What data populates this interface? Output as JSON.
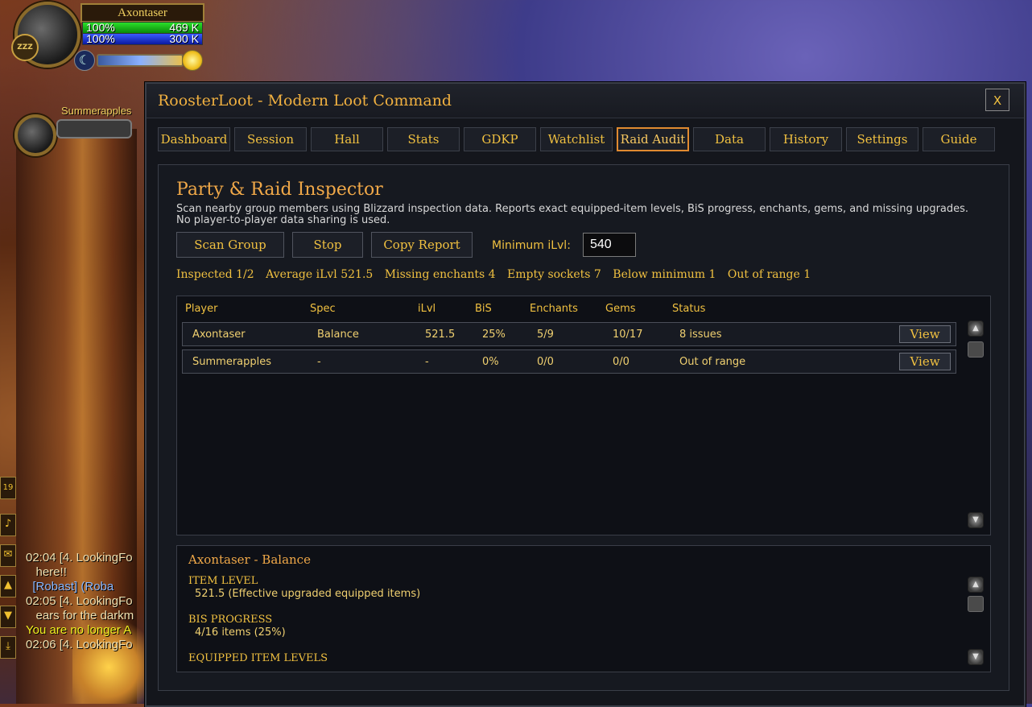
{
  "player": {
    "name": "Axontaser",
    "hp_pct": "100%",
    "hp_val": "469 K",
    "mp_pct": "100%",
    "mp_val": "300 K",
    "rest": "ZZZ"
  },
  "party": {
    "name": "Summerapples"
  },
  "chat": {
    "button_count": "19",
    "lines": [
      {
        "text": "02:04 [4. LookingFo",
        "kind": "normal"
      },
      {
        "text": "   here!!",
        "kind": "normal"
      },
      {
        "text": "  [Robast] (Roba",
        "kind": "who"
      },
      {
        "text": "02:05 [4. LookingFo",
        "kind": "normal"
      },
      {
        "text": "   ears for the darkm",
        "kind": "normal"
      },
      {
        "text": "You are no longer A",
        "kind": "sys"
      },
      {
        "text": "02:06 [4. LookingFo",
        "kind": "normal"
      }
    ]
  },
  "window": {
    "title": "RoosterLoot - Modern Loot Command",
    "close_label": "X",
    "tabs": [
      "Dashboard",
      "Session",
      "Hall",
      "Stats",
      "GDKP",
      "Watchlist",
      "Raid Audit",
      "Data",
      "History",
      "Settings",
      "Guide"
    ],
    "active_tab": "Raid Audit"
  },
  "inspector": {
    "title": "Party & Raid Inspector",
    "description": "Scan nearby group members using Blizzard inspection data. Reports exact equipped-item levels, BiS progress, enchants, gems, and missing upgrades. No player-to-player data sharing is used.",
    "scan_label": "Scan Group",
    "stop_label": "Stop",
    "copy_label": "Copy Report",
    "min_ilvl_label": "Minimum iLvl:",
    "min_ilvl_value": "540",
    "summary": {
      "inspected": "Inspected 1/2",
      "avg": "Average iLvl 521.5",
      "enchants": "Missing enchants 4",
      "sockets": "Empty sockets 7",
      "below": "Below minimum 1",
      "range": "Out of range 1"
    },
    "columns": [
      "Player",
      "Spec",
      "iLvl",
      "BiS",
      "Enchants",
      "Gems",
      "Status"
    ],
    "rows": [
      {
        "player": "Axontaser",
        "spec": "Balance",
        "ilvl": "521.5",
        "bis": "25%",
        "enchants": "5/9",
        "gems": "10/17",
        "status": "8 issues",
        "view": "View"
      },
      {
        "player": "Summerapples",
        "spec": "-",
        "ilvl": "-",
        "bis": "0%",
        "enchants": "0/0",
        "gems": "0/0",
        "status": "Out of range",
        "view": "View"
      }
    ]
  },
  "detail": {
    "title": "Axontaser - Balance",
    "item_level_heading": "ITEM LEVEL",
    "item_level_value": "521.5 (Effective upgraded equipped items)",
    "bis_heading": "BIS PROGRESS",
    "bis_value": "4/16 items (25%)",
    "equipped_heading": "EQUIPPED ITEM LEVELS"
  }
}
